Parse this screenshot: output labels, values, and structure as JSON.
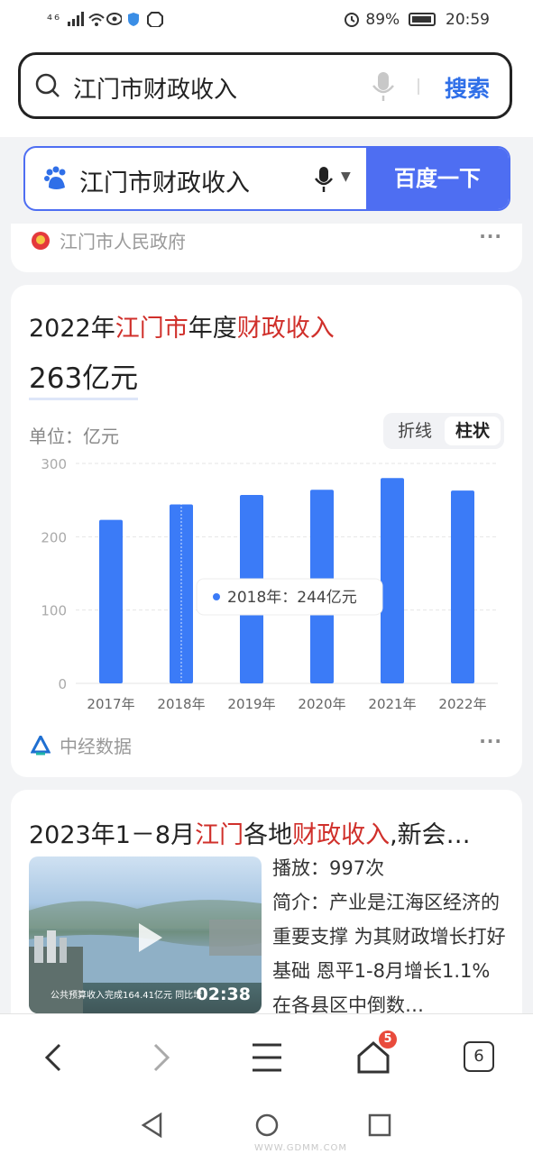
{
  "status_bar": {
    "signal": "⁴⁶",
    "battery": "89%",
    "time": "20:59"
  },
  "top_search": {
    "query": "江门市财政收入",
    "button": "搜索"
  },
  "baidu_search": {
    "query": "江门市财政收入",
    "button": "百度一下"
  },
  "card_prev": {
    "source": "江门市人民政府",
    "more": "···"
  },
  "answer_card": {
    "title_parts": [
      "2022年",
      "江门市",
      "年度",
      "财政收入"
    ],
    "value": "263亿元",
    "unit": "单位：亿元",
    "toggle_line": "折线",
    "toggle_bar": "柱状",
    "tooltip": "2018年：244亿元",
    "source": "中经数据",
    "more": "···"
  },
  "chart_data": {
    "type": "bar",
    "categories": [
      "2017年",
      "2018年",
      "2019年",
      "2020年",
      "2021年",
      "2022年"
    ],
    "values": [
      223,
      244,
      257,
      264,
      280,
      263
    ],
    "y_ticks": [
      "0",
      "100",
      "200",
      "300"
    ],
    "ylim": [
      0,
      300
    ],
    "grid": true,
    "highlighted": "2018年",
    "color": "#3b7bf7"
  },
  "video_card": {
    "title_parts": [
      "2023年1－8月",
      "江门",
      "各地",
      "财政收入",
      ",新会…"
    ],
    "plays": "播放：997次",
    "desc": "简介：产业是江海区经济的重要支撑 为其财政增长打好基础 恩平1-8月增长1.1%在各县区中倒数…",
    "duration": "02:38",
    "caption": "公共预算收入完成164.41亿元 同比增"
  },
  "nav": {
    "tabs_badge": "5",
    "tab_count": "6"
  },
  "watermark": "WWW.GDMM.COM"
}
